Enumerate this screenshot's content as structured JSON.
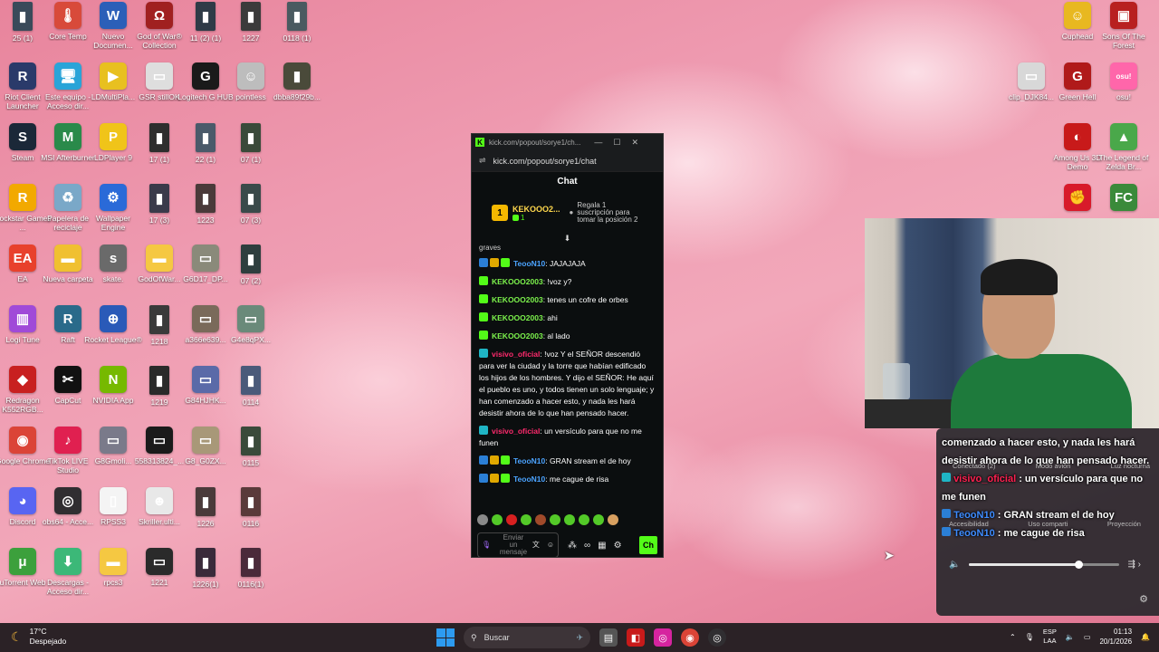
{
  "desktop_icons": [
    {
      "label": "25 (1)",
      "glyph": "▮",
      "color": "#3a4a5a",
      "tall": true
    },
    {
      "label": "Core Temp",
      "glyph": "🌡",
      "color": "#d84a3a"
    },
    {
      "label": "Nuevo Documen...",
      "glyph": "W",
      "color": "#2b5fb8"
    },
    {
      "label": "God of War® Collection",
      "glyph": "Ω",
      "color": "#a02020"
    },
    {
      "label": "11 (2) (1)",
      "glyph": "▮",
      "color": "#2f3b47",
      "tall": true
    },
    {
      "label": "1227",
      "glyph": "▮",
      "color": "#3b3b3b",
      "tall": true
    },
    {
      "label": "0118 (1)",
      "glyph": "▮",
      "color": "#4a5a60",
      "tall": true
    },
    {
      "label": "Riot Client Launcher",
      "glyph": "R",
      "color": "#2a3a6a"
    },
    {
      "label": "Este equipo - Acceso dir...",
      "glyph": "🖥",
      "color": "#2aa4d8"
    },
    {
      "label": "LDMultiPla...",
      "glyph": "▶",
      "color": "#e8c020"
    },
    {
      "label": "GSR stillOK",
      "glyph": "▭",
      "color": "#dedede"
    },
    {
      "label": "Logitech G HUB",
      "glyph": "G",
      "color": "#1a1a1a"
    },
    {
      "label": "pointless",
      "glyph": "☺",
      "color": "#bdbdbd"
    },
    {
      "label": "dbba89f29b...",
      "glyph": "▮",
      "color": "#4a4a3a"
    },
    {
      "label": "Steam",
      "glyph": "S",
      "color": "#1b2838"
    },
    {
      "label": "MSI Afterburner",
      "glyph": "M",
      "color": "#2a8a4a"
    },
    {
      "label": "LDPlayer 9",
      "glyph": "P",
      "color": "#f0c419"
    },
    {
      "label": "17 (1)",
      "glyph": "▮",
      "color": "#2e2e2e",
      "tall": true
    },
    {
      "label": "22 (1)",
      "glyph": "▮",
      "color": "#4a5a6a",
      "tall": true
    },
    {
      "label": "07 (1)",
      "glyph": "▮",
      "color": "#3a4a3a",
      "tall": true
    },
    {
      "label": "Rockstar Games ...",
      "glyph": "R",
      "color": "#f2a900"
    },
    {
      "label": "Papelera de reciclaje",
      "glyph": "♻",
      "color": "#7aa8c8"
    },
    {
      "label": "Wallpaper Engine",
      "glyph": "⚙",
      "color": "#2a6ad8"
    },
    {
      "label": "17 (3)",
      "glyph": "▮",
      "color": "#3a3a4a",
      "tall": true
    },
    {
      "label": "1223",
      "glyph": "▮",
      "color": "#4a3a3a",
      "tall": true
    },
    {
      "label": "07 (3)",
      "glyph": "▮",
      "color": "#3a4a4a",
      "tall": true
    },
    {
      "label": "EA",
      "glyph": "EA",
      "color": "#e8412c"
    },
    {
      "label": "Nueva carpeta",
      "glyph": "▬",
      "color": "#f0c030"
    },
    {
      "label": "skate.",
      "glyph": "s",
      "color": "#6a6a6a"
    },
    {
      "label": "GodOfWar...",
      "glyph": "▬",
      "color": "#f5c842"
    },
    {
      "label": "G6D17_DP...",
      "glyph": "▭",
      "color": "#8a8a7a"
    },
    {
      "label": "07 (2)",
      "glyph": "▮",
      "color": "#2e3e3e",
      "tall": true
    },
    {
      "label": "Logi Tune",
      "glyph": "▥",
      "color": "#a04ad8"
    },
    {
      "label": "Raft",
      "glyph": "R",
      "color": "#2a6a8a"
    },
    {
      "label": "Rocket League®",
      "glyph": "⊕",
      "color": "#2a5ab8"
    },
    {
      "label": "1218",
      "glyph": "▮",
      "color": "#3a3a3a",
      "tall": true
    },
    {
      "label": "a366e639...",
      "glyph": "▭",
      "color": "#7a6a5a"
    },
    {
      "label": "G4e8qPX...",
      "glyph": "▭",
      "color": "#6a8a7a"
    },
    {
      "label": "Redragon K552RGB...",
      "glyph": "◆",
      "color": "#c82020"
    },
    {
      "label": "CapCut",
      "glyph": "✂",
      "color": "#111111"
    },
    {
      "label": "NVIDIA App",
      "glyph": "N",
      "color": "#76b900"
    },
    {
      "label": "1219",
      "glyph": "▮",
      "color": "#2a2a2a",
      "tall": true
    },
    {
      "label": "G84HJHK...",
      "glyph": "▭",
      "color": "#5a6aa8"
    },
    {
      "label": "0114",
      "glyph": "▮",
      "color": "#4a5a7a",
      "tall": true
    },
    {
      "label": "Google Chrome",
      "glyph": "◉",
      "color": "#db4437"
    },
    {
      "label": "TikTok LIVE Studio",
      "glyph": "♪",
      "color": "#e02050"
    },
    {
      "label": "G8Gmoli...",
      "glyph": "▭",
      "color": "#7a7a8a"
    },
    {
      "label": "558313824_...",
      "glyph": "▭",
      "color": "#1a1a1a"
    },
    {
      "label": "G8_G0ZX...",
      "glyph": "▭",
      "color": "#a89878"
    },
    {
      "label": "0115",
      "glyph": "▮",
      "color": "#3a4a3a",
      "tall": true
    },
    {
      "label": "Discord",
      "glyph": "◕",
      "color": "#5865f2"
    },
    {
      "label": "obs64 - Acce...",
      "glyph": "◎",
      "color": "#302e31"
    },
    {
      "label": "RPSS3",
      "glyph": "▯",
      "color": "#f4f4f4"
    },
    {
      "label": "Skriller.ulti...",
      "glyph": "☻",
      "color": "#e8e8e8"
    },
    {
      "label": "1226",
      "glyph": "▮",
      "color": "#4a3a3a",
      "tall": true
    },
    {
      "label": "0116",
      "glyph": "▮",
      "color": "#5a3a3a",
      "tall": true
    },
    {
      "label": "uTorrent Web",
      "glyph": "μ",
      "color": "#3ca03c"
    },
    {
      "label": "Descargas - Acceso dir...",
      "glyph": "⬇",
      "color": "#3cb878"
    },
    {
      "label": "rpcs3",
      "glyph": "▬",
      "color": "#f5c842"
    },
    {
      "label": "1221",
      "glyph": "▭",
      "color": "#2a2a2a"
    },
    {
      "label": "1226(1)",
      "glyph": "▮",
      "color": "#3a2a3a",
      "tall": true
    },
    {
      "label": "0116(1)",
      "glyph": "▮",
      "color": "#4a2a3a",
      "tall": true
    },
    {
      "label": "Cuphead",
      "glyph": "☺",
      "color": "#e8b820"
    },
    {
      "label": "Sons Of The Forest",
      "glyph": "▣",
      "color": "#b82020"
    },
    {
      "label": "clip_DJK84...",
      "glyph": "▭",
      "color": "#d8d8d8"
    },
    {
      "label": "Green Hell",
      "glyph": "G",
      "color": "#b01a1a"
    },
    {
      "label": "osu!",
      "glyph": "osu!",
      "color": "#ff66aa"
    },
    {
      "label": "Among Us 3D Demo",
      "glyph": "◐",
      "color": "#c81a1a"
    },
    {
      "label": "The Legend of Zelda Br...",
      "glyph": "▲",
      "color": "#4aa84a"
    },
    {
      "label": "",
      "glyph": "✊",
      "color": "#d81a2a"
    },
    {
      "label": "",
      "glyph": "FC",
      "color": "#3a8a3a"
    }
  ],
  "kick_window": {
    "tab_title": "kick.com/popout/sorye1/ch...",
    "url": "kick.com/popout/sorye1/chat",
    "chat_title": "Chat",
    "top_gifter": {
      "rank": "1",
      "name": "KEKOOO2...",
      "count": "1"
    },
    "gift_prompt": "Regala 1 suscripción para tomar la posición 2",
    "partial_line": "graves",
    "messages": [
      {
        "badges": [
          "blue",
          "gold",
          "green"
        ],
        "user": "TeooN10",
        "user_color": "blue",
        "text": ": JAJAJAJA"
      },
      {
        "badges": [
          "green"
        ],
        "user": "KEKOOO2003",
        "user_color": "green",
        "text": ": !voz y?"
      },
      {
        "badges": [
          "green"
        ],
        "user": "KEKOOO2003",
        "user_color": "green",
        "text": ": tenes un cofre de orbes"
      },
      {
        "badges": [
          "green"
        ],
        "user": "KEKOOO2003",
        "user_color": "green",
        "text": ": ahi"
      },
      {
        "badges": [
          "green"
        ],
        "user": "KEKOOO2003",
        "user_color": "green",
        "text": ": al lado"
      },
      {
        "badges": [
          "teal"
        ],
        "user": "visivo_oficial",
        "user_color": "red",
        "text": ": !voz Y el SEÑOR descendió para ver la ciudad y la torre que habían edificado los hijos de los hombres. Y dijo el SEÑOR: He aquí el pueblo es uno, y todos tienen un solo lenguaje; y han comenzado a hacer esto, y nada les hará desistir ahora de lo que han pensado hacer."
      },
      {
        "badges": [
          "teal"
        ],
        "user": "visivo_oficial",
        "user_color": "red",
        "text": ": un versículo para que no me funen"
      },
      {
        "badges": [
          "blue",
          "gold",
          "green"
        ],
        "user": "TeooN10",
        "user_color": "blue",
        "text": ": GRAN stream el de hoy"
      },
      {
        "badges": [
          "blue",
          "gold",
          "green"
        ],
        "user": "TeooN10",
        "user_color": "blue",
        "text": ": me cague de risa"
      }
    ],
    "input_placeholder": "Enviar un mensaje",
    "send_label": "Ch"
  },
  "overlay_chat": {
    "line1": "comenzado a hacer esto, y nada les hará desistir ahora de lo que han pensado hacer.",
    "line2_user": "visivo_oficial",
    "line2_text": " : un versículo para que no me funen",
    "line3_user": "TeooN10",
    "line3_text": " : GRAN stream el de hoy",
    "line4_user": "TeooN10",
    "line4_text": " : me cague de risa"
  },
  "quick_settings": {
    "labels_top": [
      "Conectado (2)",
      "Modo avión",
      "Luz nocturna"
    ],
    "labels_bottom": [
      "Accesibilidad",
      "Uso comparti",
      "Proyección"
    ],
    "volume_level": 0.73
  },
  "taskbar": {
    "weather_temp": "17°C",
    "weather_desc": "Despejado",
    "search_placeholder": "Buscar",
    "lang_line1": "ESP",
    "lang_line2": "LAA",
    "time": "01:13",
    "date": "20/1/2026"
  }
}
